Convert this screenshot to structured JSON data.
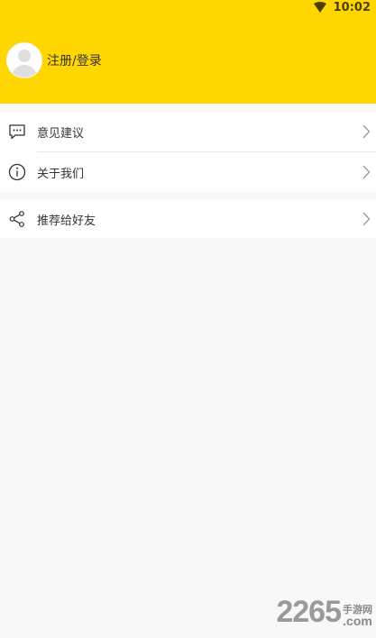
{
  "status_bar": {
    "time": "10:02",
    "wifi_icon": "wifi-icon"
  },
  "profile": {
    "login_label": "注册/登录",
    "avatar_icon": "default-avatar-icon"
  },
  "menu_group_1": [
    {
      "label": "意见建议",
      "icon": "chat-bubble-icon"
    },
    {
      "label": "关于我们",
      "icon": "info-icon"
    }
  ],
  "menu_group_2": [
    {
      "label": "推荐给好友",
      "icon": "share-icon"
    }
  ],
  "watermark": {
    "number": "2265",
    "top_text": "手游网",
    "bottom_text": ".com"
  },
  "colors": {
    "header_bg": "#ffd600",
    "page_bg": "#f8f8f8"
  }
}
